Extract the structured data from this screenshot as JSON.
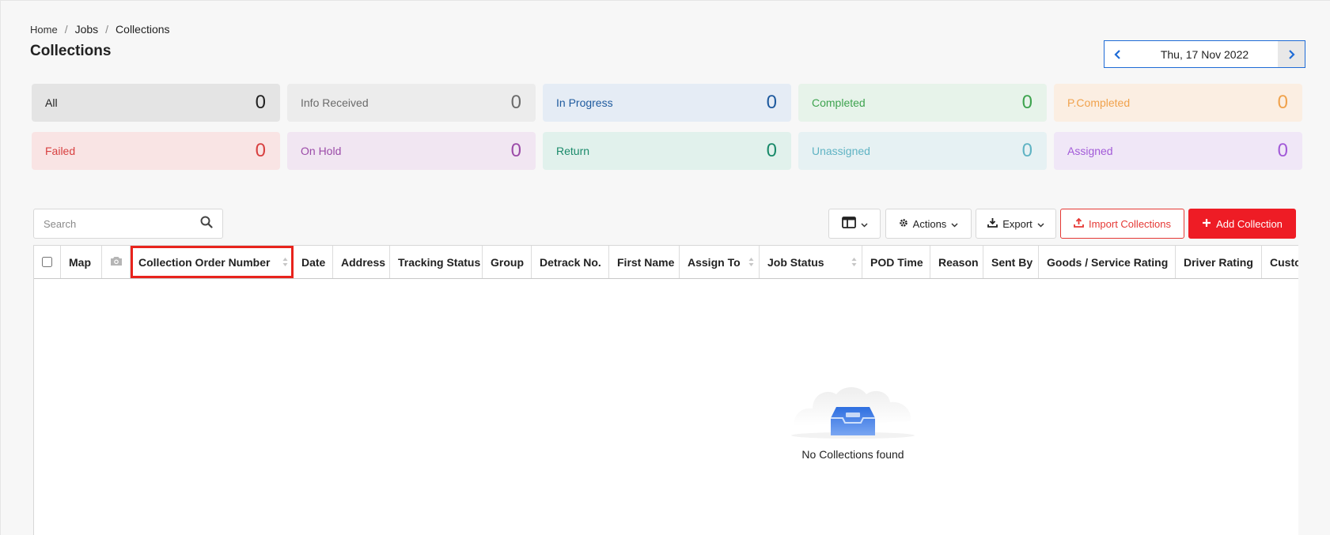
{
  "breadcrumb": {
    "home": "Home",
    "jobs": "Jobs",
    "current": "Collections"
  },
  "page_title": "Collections",
  "date_nav": {
    "date": "Thu, 17 Nov 2022"
  },
  "status_cards": [
    {
      "label": "All",
      "count": "0",
      "bg": "#e4e4e4",
      "color": "#222222"
    },
    {
      "label": "Info Received",
      "count": "0",
      "bg": "#ececec",
      "color": "#6b6b6b"
    },
    {
      "label": "In Progress",
      "count": "0",
      "bg": "#e5ecf5",
      "color": "#1e5a9e"
    },
    {
      "label": "Completed",
      "count": "0",
      "bg": "#e7f3ea",
      "color": "#3ea34f"
    },
    {
      "label": "P.Completed",
      "count": "0",
      "bg": "#fbeee2",
      "color": "#f0a24c"
    },
    {
      "label": "Failed",
      "count": "0",
      "bg": "#f9e4e4",
      "color": "#d84040"
    },
    {
      "label": "On Hold",
      "count": "0",
      "bg": "#f1e6f2",
      "color": "#9b4aa8"
    },
    {
      "label": "Return",
      "count": "0",
      "bg": "#e1f1ec",
      "color": "#1a8a6a"
    },
    {
      "label": "Unassigned",
      "count": "0",
      "bg": "#e6f1f3",
      "color": "#5fb3c3"
    },
    {
      "label": "Assigned",
      "count": "0",
      "bg": "#f0e7f7",
      "color": "#a25ad8"
    }
  ],
  "search": {
    "placeholder": "Search"
  },
  "toolbar": {
    "actions_label": "Actions",
    "export_label": "Export",
    "import_label": "Import Collections",
    "add_label": "Add Collection"
  },
  "table": {
    "columns": {
      "map": "Map",
      "order_no": "Collection Order Number",
      "date": "Date",
      "address": "Address",
      "tracking_status": "Tracking Status",
      "group": "Group",
      "detrack_no": "Detrack No.",
      "first_name": "First Name",
      "assign_to": "Assign To",
      "job_status": "Job Status",
      "pod_time": "POD Time",
      "reason": "Reason",
      "sent_by": "Sent By",
      "rating": "Goods / Service Rating",
      "driver_rating": "Driver Rating",
      "customer": "Custom"
    },
    "empty_message": "No Collections found"
  },
  "colors": {
    "accent": "#1e6bd6",
    "danger": "#ee1c25",
    "highlight": "#e8231c"
  },
  "icons": [
    "chevron-left-icon",
    "chevron-right-icon",
    "search-icon",
    "columns-icon",
    "gear-icon",
    "download-icon",
    "upload-icon",
    "plus-icon",
    "camera-icon",
    "sort-icon",
    "empty-inbox-icon"
  ]
}
